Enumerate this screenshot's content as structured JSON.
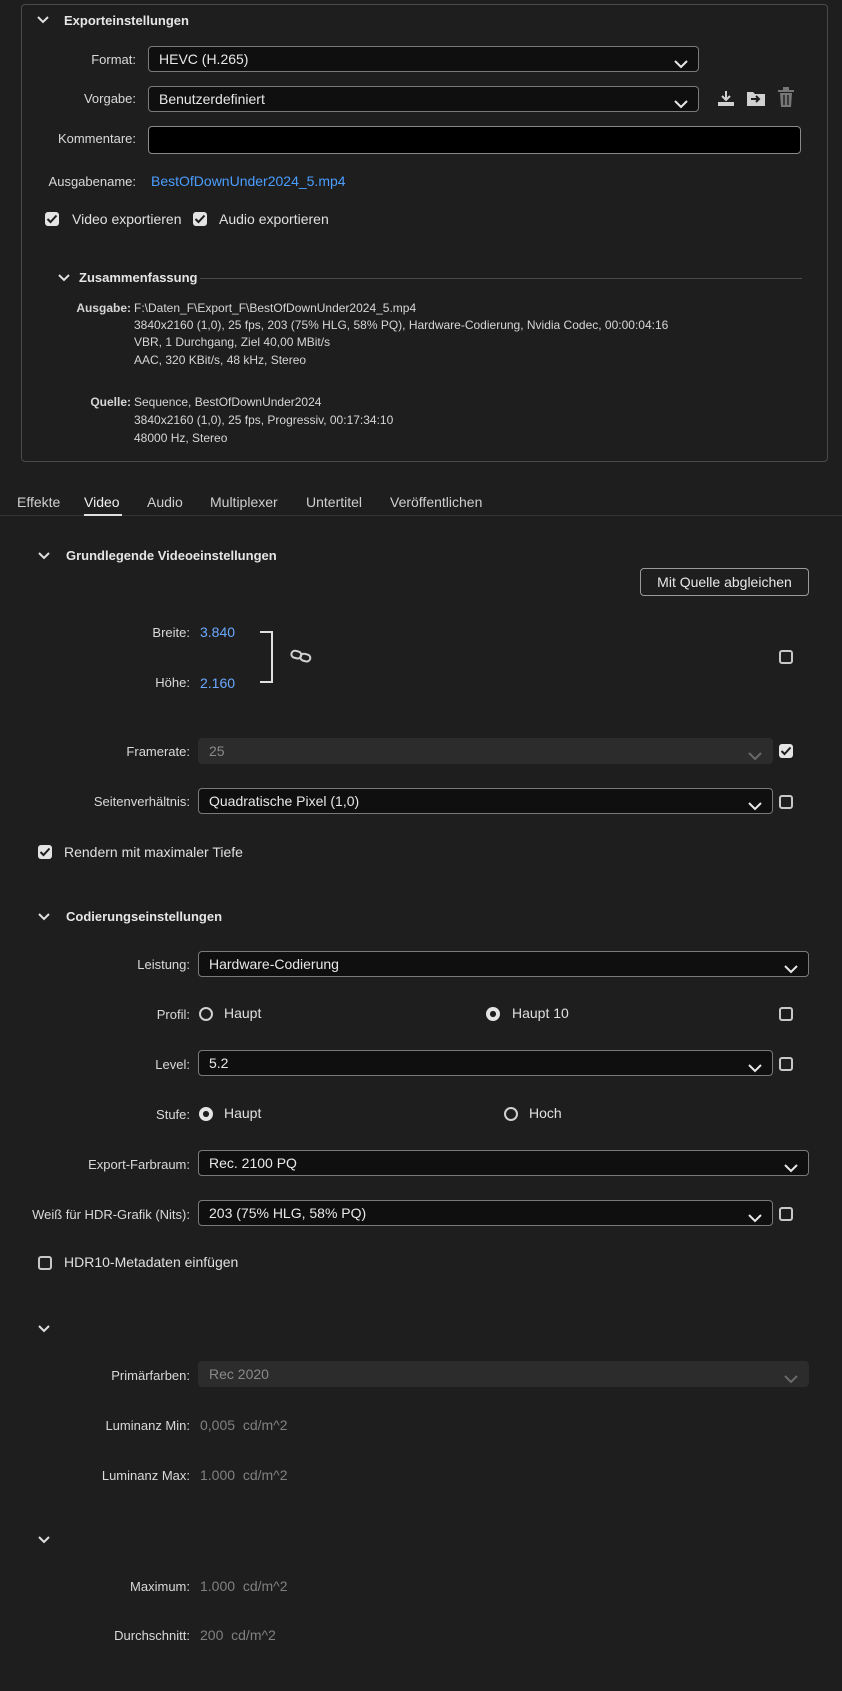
{
  "export_settings": {
    "title": "Exporteinstellungen",
    "format_label": "Format:",
    "format_value": "HEVC (H.265)",
    "preset_label": "Vorgabe:",
    "preset_value": "Benutzerdefiniert",
    "comments_label": "Kommentare:",
    "comments_value": "",
    "output_name_label": "Ausgabename:",
    "output_name_value": "BestOfDownUnder2024_5.mp4",
    "video_export_label": "Video exportieren",
    "video_export_checked": true,
    "audio_export_label": "Audio exportieren",
    "audio_export_checked": true
  },
  "summary": {
    "title": "Zusammenfassung",
    "output_label": "Ausgabe:",
    "output_lines": [
      "F:\\Daten_F\\Export_F\\BestOfDownUnder2024_5.mp4",
      "3840x2160 (1,0), 25 fps, 203 (75% HLG, 58% PQ), Hardware-Codierung, Nvidia Codec, 00:00:04:16",
      "VBR, 1 Durchgang, Ziel 40,00 MBit/s",
      "AAC, 320 KBit/s, 48 kHz, Stereo"
    ],
    "source_label": "Quelle:",
    "source_lines": [
      "Sequence, BestOfDownUnder2024",
      "3840x2160 (1,0), 25 fps, Progressiv, 00:17:34:10",
      "48000 Hz, Stereo"
    ]
  },
  "tabs": [
    {
      "label": "Effekte",
      "active": false
    },
    {
      "label": "Video",
      "active": true
    },
    {
      "label": "Audio",
      "active": false
    },
    {
      "label": "Multiplexer",
      "active": false
    },
    {
      "label": "Untertitel",
      "active": false
    },
    {
      "label": "Veröffentlichen",
      "active": false
    }
  ],
  "basic_video": {
    "title": "Grundlegende Videoeinstellungen",
    "match_source_button": "Mit Quelle abgleichen",
    "width_label": "Breite:",
    "width_value": "3.840",
    "height_label": "Höhe:",
    "height_value": "2.160",
    "framerate_label": "Framerate:",
    "framerate_value": "25",
    "framerate_checked": true,
    "aspect_label": "Seitenverhältnis:",
    "aspect_value": "Quadratische Pixel (1,0)",
    "render_max_depth_label": "Rendern mit maximaler Tiefe",
    "render_max_depth_checked": true
  },
  "encoding": {
    "title": "Codierungseinstellungen",
    "performance_label": "Leistung:",
    "performance_value": "Hardware-Codierung",
    "profile_label": "Profil:",
    "profile_option1": "Haupt",
    "profile_option2": "Haupt 10",
    "profile_selected": "Haupt 10",
    "level_label": "Level:",
    "level_value": "5.2",
    "tier_label": "Stufe:",
    "tier_option1": "Haupt",
    "tier_option2": "Hoch",
    "tier_selected": "Haupt",
    "color_space_label": "Export-Farbraum:",
    "color_space_value": "Rec. 2100 PQ",
    "hdr_white_label": "Weiß für HDR-Grafik (Nits):",
    "hdr_white_value": "203 (75% HLG, 58% PQ)",
    "hdr10_label": "HDR10-Metadaten einfügen",
    "hdr10_checked": false
  },
  "mastering": {
    "primaries_label": "Primärfarben:",
    "primaries_value": "Rec 2020",
    "lum_min_label": "Luminanz Min:",
    "lum_min_value": "0,005",
    "lum_max_label": "Luminanz Max:",
    "lum_max_value": "1.000",
    "unit": "cd/m^2"
  },
  "content_light": {
    "maximum_label": "Maximum:",
    "maximum_value": "1.000",
    "average_label": "Durchschnitt:",
    "average_value": "200",
    "unit": "cd/m^2"
  }
}
